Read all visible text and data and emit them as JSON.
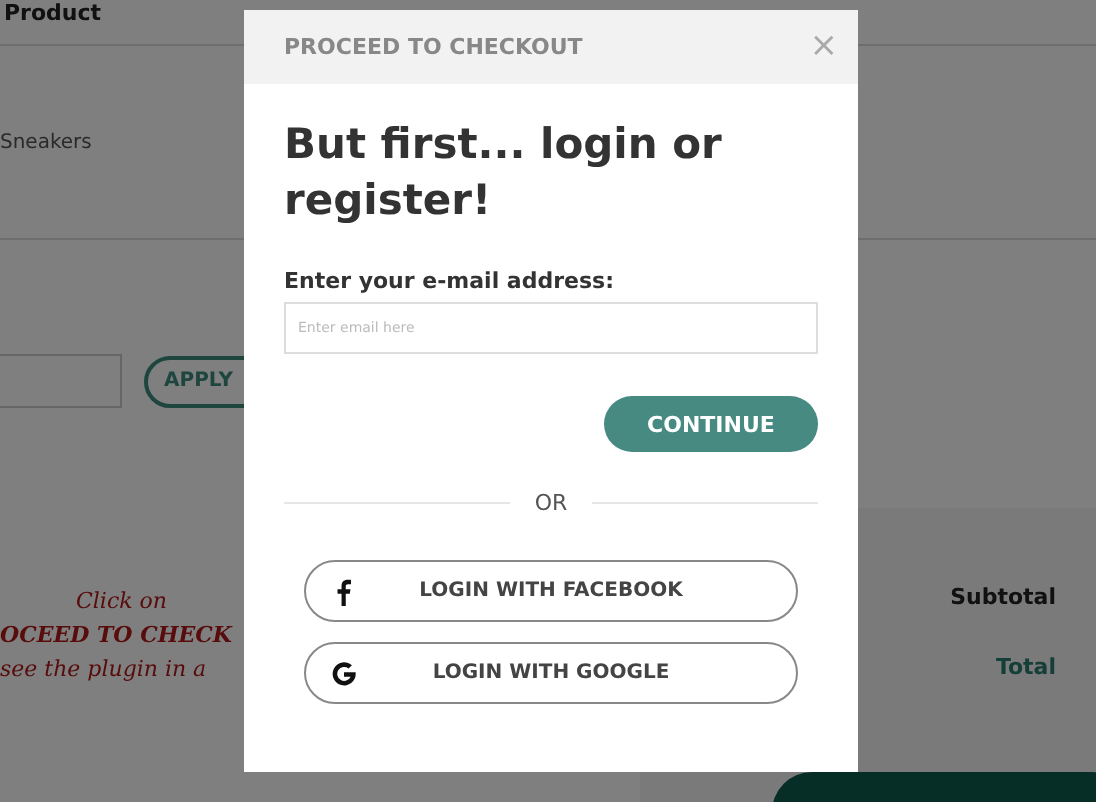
{
  "cart": {
    "columns": [
      "Product"
    ],
    "item": "Sneakers",
    "coupon_button": "APPLY",
    "totals": [
      "Subtotal",
      "Total"
    ],
    "note": [
      "Click on",
      "OCEED TO CHECK",
      "see the plugin in a"
    ]
  },
  "modal": {
    "title": "PROCEED TO CHECKOUT",
    "close": "×",
    "heading": "But first... login or register!",
    "email_label": "Enter your e-mail address:",
    "email_placeholder": "Enter email here",
    "continue": "CONTINUE",
    "divider": "OR",
    "social": [
      {
        "kind": "facebook",
        "label": "LOGIN WITH FACEBOOK"
      },
      {
        "kind": "google",
        "label": "LOGIN WITH GOOGLE"
      }
    ]
  }
}
